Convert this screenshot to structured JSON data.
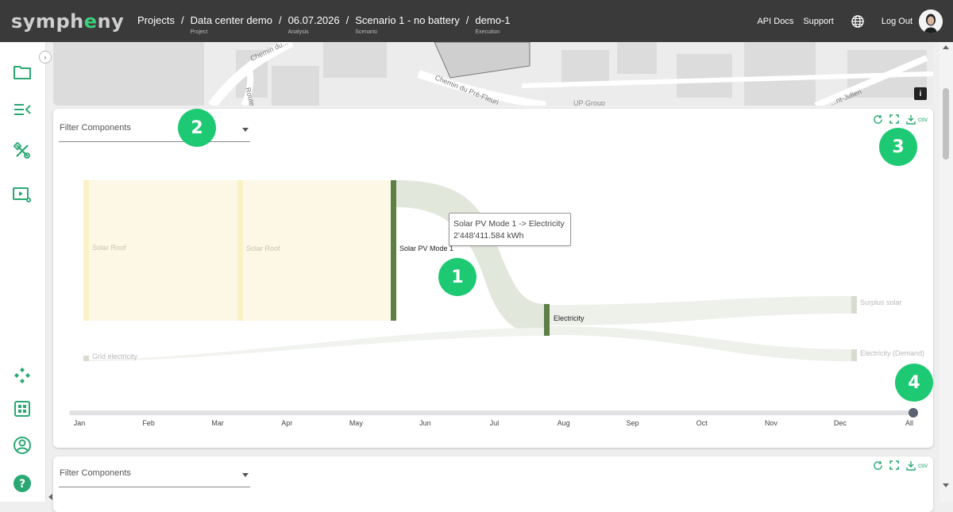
{
  "app": {
    "logo_pre": "symph",
    "logo_hl": "e",
    "logo_post": "ny"
  },
  "breadcrumb": [
    {
      "label": "Projects",
      "sub": ""
    },
    {
      "label": "Data center demo",
      "sub": "Project"
    },
    {
      "label": "06.07.2026",
      "sub": "Analysis"
    },
    {
      "label": "Scenario 1 - no battery",
      "sub": "Scenario"
    },
    {
      "label": "demo-1",
      "sub": "Execution"
    }
  ],
  "header": {
    "api_docs": "API Docs",
    "support": "Support",
    "logout": "Log Out"
  },
  "sidebar": {
    "top_items": [
      "folder-icon",
      "list-collapse-icon",
      "tools-icon",
      "video-settings-icon"
    ],
    "bottom_items": [
      "component-icon",
      "grid-icon",
      "user-circle-icon",
      "help-icon"
    ]
  },
  "map": {
    "streets": [
      "Chemin du...",
      "Route...",
      "Chemin du Pré-Fleuri",
      "UP Group",
      "...nt-Julien"
    ],
    "info": "i"
  },
  "card1": {
    "filter_placeholder": "Filter Components",
    "csv": "csv",
    "sankey_nodes": {
      "solar_roof_1": "Solar Roof",
      "solar_roof_2": "Solar Roof",
      "solar_pv": "Solar PV Mode 1",
      "electricity": "Electricity",
      "grid": "Grid electricity",
      "surplus": "Surplus solar",
      "demand": "Electricity (Demand)"
    },
    "tooltip": {
      "title": "Solar PV Mode 1 -> Electricity",
      "value": "2'448'411.584 kWh"
    },
    "timeline": {
      "labels": [
        "Jan",
        "Feb",
        "Mar",
        "Apr",
        "May",
        "Jun",
        "Jul",
        "Aug",
        "Sep",
        "Oct",
        "Nov",
        "Dec",
        "All"
      ],
      "selected": "All"
    }
  },
  "card2": {
    "filter_placeholder": "Filter Components",
    "csv": "csv"
  },
  "badges": {
    "b1": "1",
    "b2": "2",
    "b3": "3",
    "b4": "4"
  },
  "colors": {
    "accent": "#2aa872",
    "badge": "#1ec973",
    "node_dark": "#5b7f45",
    "solar_roof": "#fbf1c4",
    "topbar": "#3a3a3a"
  }
}
